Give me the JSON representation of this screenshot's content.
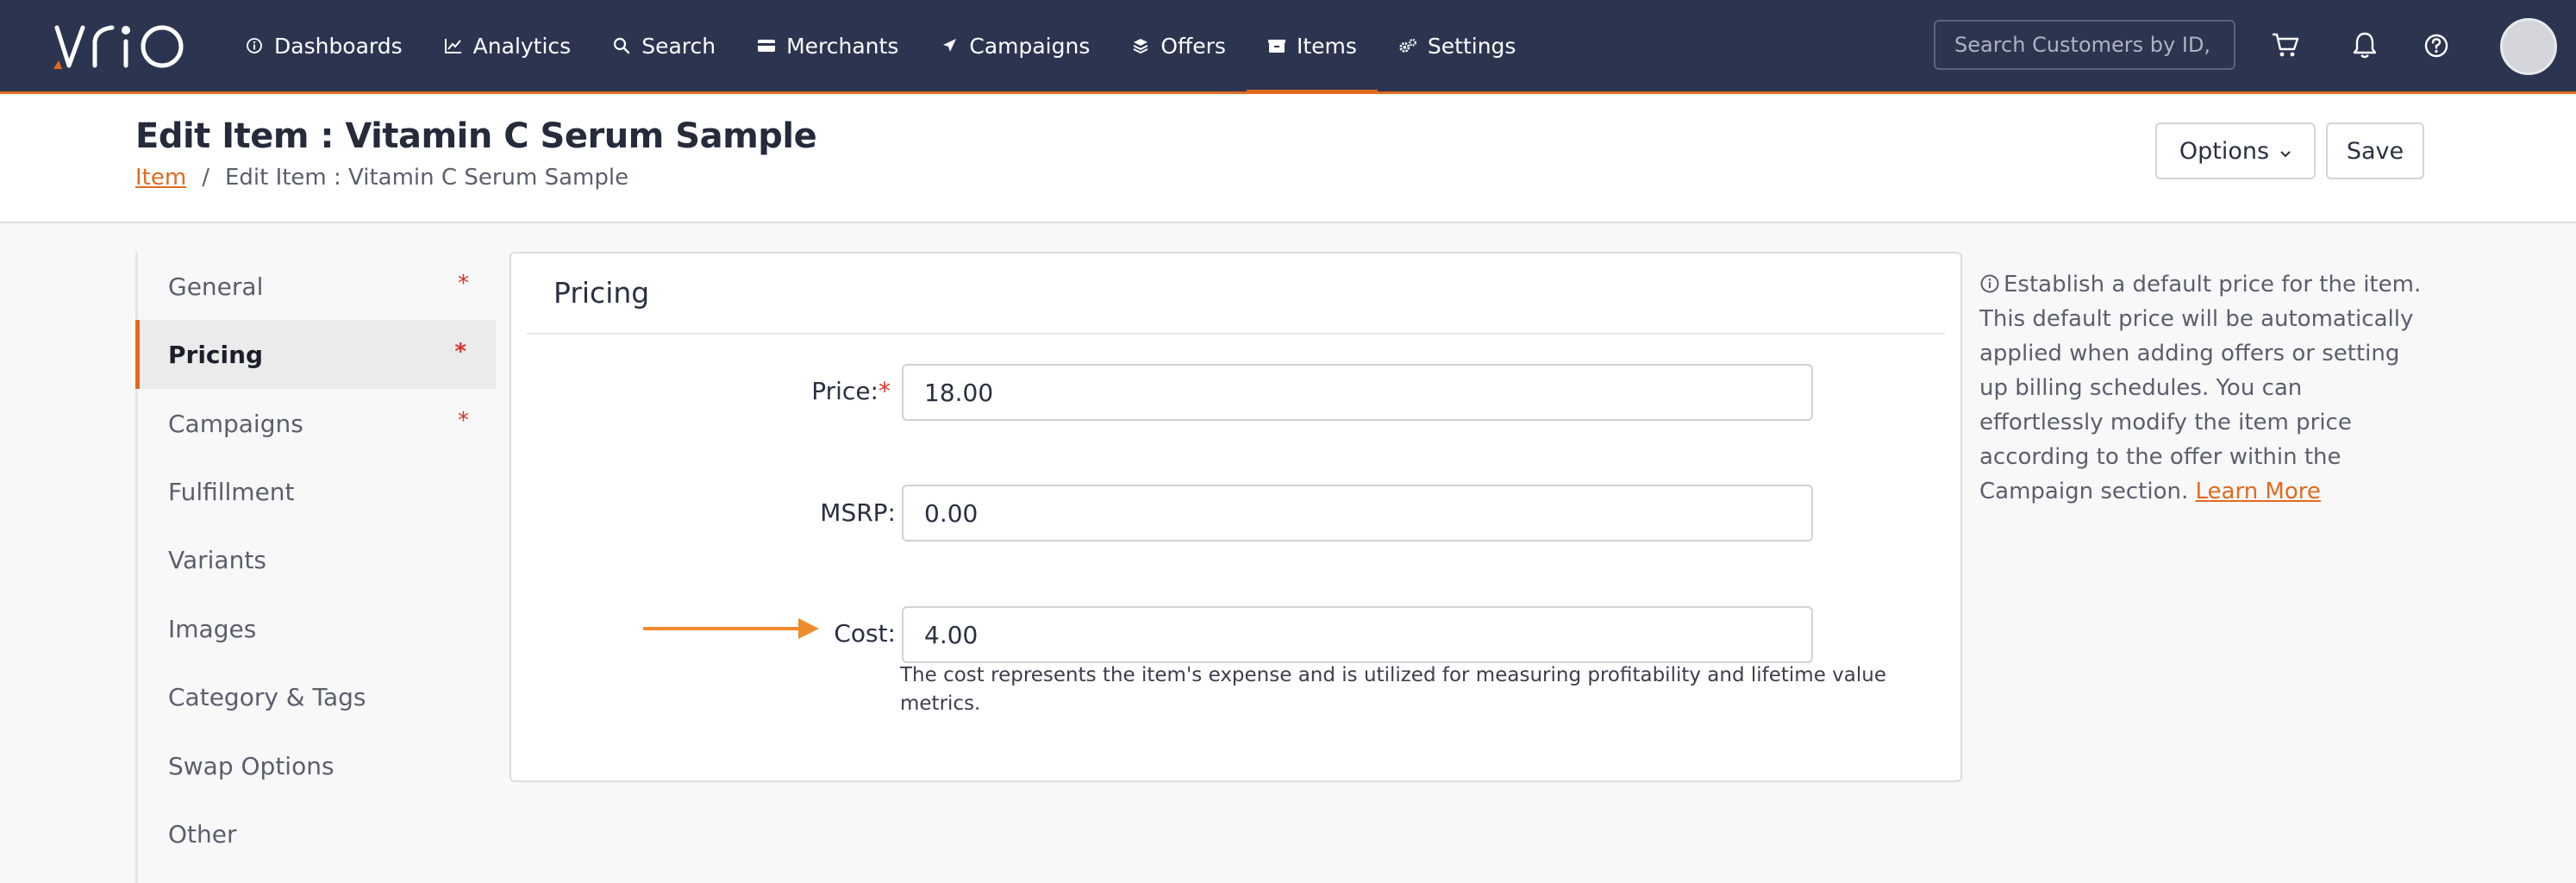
{
  "brand": {
    "logo_text": "vrio",
    "accent": "#e06b1f",
    "nav_bg": "#2c3550"
  },
  "nav": {
    "items": [
      {
        "label": "Dashboards",
        "icon": "info-circle-icon"
      },
      {
        "label": "Analytics",
        "icon": "line-chart-icon"
      },
      {
        "label": "Search",
        "icon": "search-icon"
      },
      {
        "label": "Merchants",
        "icon": "credit-card-icon"
      },
      {
        "label": "Campaigns",
        "icon": "paper-plane-icon"
      },
      {
        "label": "Offers",
        "icon": "layers-icon"
      },
      {
        "label": "Items",
        "icon": "box-icon",
        "active": true
      },
      {
        "label": "Settings",
        "icon": "gears-icon"
      }
    ],
    "search_placeholder": "Search Customers by ID, Em",
    "icons": [
      "cart-icon",
      "bell-icon",
      "help-icon",
      "avatar"
    ]
  },
  "header": {
    "title": "Edit Item : Vitamin C Serum Sample",
    "breadcrumb": {
      "link": "Item",
      "separator": "/",
      "current": "Edit Item : Vitamin C Serum Sample"
    },
    "options_label": "Options",
    "save_label": "Save"
  },
  "sidemenu": {
    "items": [
      {
        "label": "General",
        "required": "*"
      },
      {
        "label": "Pricing",
        "required": "*",
        "active": true
      },
      {
        "label": "Campaigns",
        "required": "*"
      },
      {
        "label": "Fulfillment",
        "required": ""
      },
      {
        "label": "Variants",
        "required": ""
      },
      {
        "label": "Images",
        "required": ""
      },
      {
        "label": "Category & Tags",
        "required": ""
      },
      {
        "label": "Swap Options",
        "required": ""
      },
      {
        "label": "Other",
        "required": ""
      }
    ]
  },
  "panel": {
    "title": "Pricing",
    "fields": {
      "price": {
        "label": "Price:",
        "required": "*",
        "value": "18.00"
      },
      "msrp": {
        "label": "MSRP:",
        "value": "0.00"
      },
      "cost": {
        "label": "Cost:",
        "value": "4.00"
      }
    },
    "cost_help": "The cost represents the item's expense and is utilized for measuring profitability and lifetime value metrics."
  },
  "info": {
    "text": "Establish a default price for the item. This default price will be automatically applied when adding offers or setting up billing schedules. You can effortlessly modify the item price according to the offer within the Campaign section.",
    "link": "Learn More"
  }
}
